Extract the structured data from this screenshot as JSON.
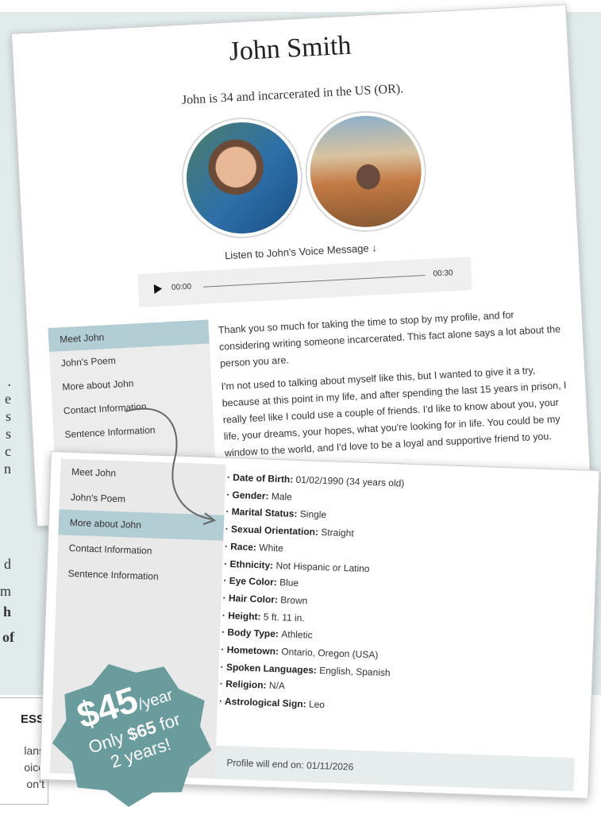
{
  "background": {
    "side_text_lines": [
      ".",
      "e",
      "s",
      "s",
      "c",
      "n"
    ],
    "side_text_bottom": [
      "d",
      "m",
      "h",
      "of"
    ],
    "bottom_box": {
      "title": "ESS",
      "lines": [
        "lans",
        "oice",
        "on’t"
      ]
    }
  },
  "profile": {
    "name": "John Smith",
    "subtitle": "John is 34 and incarcerated in the US (OR).",
    "listen_label": "Listen to John's Voice Message ↓",
    "audio": {
      "current": "00:00",
      "duration": "00:30"
    },
    "nav": [
      "Meet John",
      "John's Poem",
      "More about John",
      "Contact Information",
      "Sentence Information"
    ],
    "nav_active_index": 0,
    "intro_paragraphs": [
      "Thank you so much for taking the time to stop by my profile, and for considering writing someone incarcerated. This fact alone says a lot about the person you are.",
      "I'm not used to talking about myself like this, but I wanted to give it a try, because at this point in my life, and after spending the last 15 years in prison, I really feel like I could use a couple of friends. I'd like to know about you, your life, your dreams, your hopes, what you're looking for in life. You could be my window to the world, and I'd love to be a loyal and supportive friend to you."
    ]
  },
  "details": {
    "nav": [
      "Meet John",
      "John's Poem",
      "More about John",
      "Contact Information",
      "Sentence Information"
    ],
    "nav_active_index": 2,
    "rows": [
      {
        "label": "Date of Birth:",
        "value": "01/02/1990 (34 years old)"
      },
      {
        "label": "Gender:",
        "value": "Male"
      },
      {
        "label": "Marital Status:",
        "value": "Single"
      },
      {
        "label": "Sexual Orientation:",
        "value": "Straight"
      },
      {
        "label": "Race:",
        "value": "White"
      },
      {
        "label": "Ethnicity:",
        "value": "Not Hispanic or Latino"
      },
      {
        "label": "Eye Color:",
        "value": "Blue"
      },
      {
        "label": "Hair Color:",
        "value": "Brown"
      },
      {
        "label": "Height:",
        "value": "5 ft. 11 in."
      },
      {
        "label": "Body Type:",
        "value": "Athletic"
      },
      {
        "label": "Hometown:",
        "value": "Ontario, Oregon (USA)"
      },
      {
        "label": "Spoken Languages:",
        "value": "English, Spanish"
      },
      {
        "label": "Religion:",
        "value": "N/A"
      },
      {
        "label": "Astrological Sign:",
        "value": "Leo"
      }
    ],
    "footer_label": "Profile will end on:",
    "footer_value": "01/11/2026"
  },
  "badge": {
    "price": "$45",
    "per": "/year",
    "line2_prefix": "Only ",
    "line2_price": "$65",
    "line2_suffix": " for",
    "line3": "2 years!",
    "color": "#6a9c9d"
  }
}
